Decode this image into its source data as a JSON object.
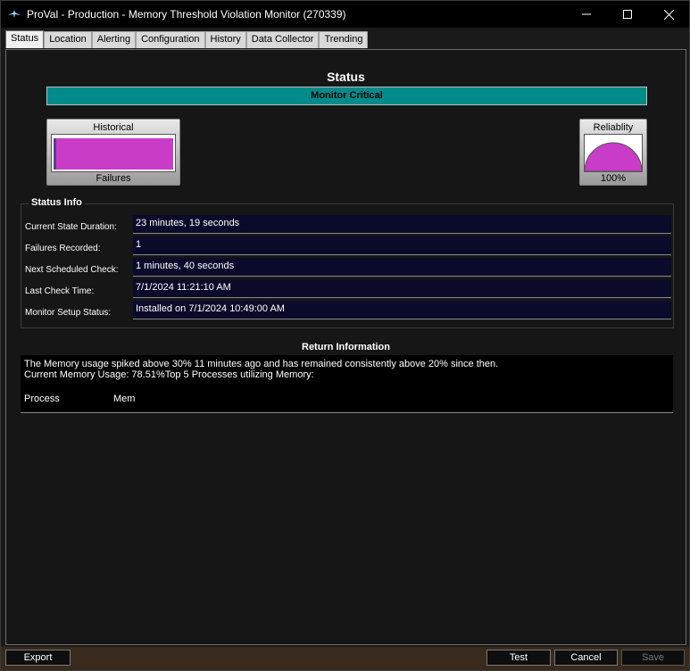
{
  "window": {
    "title": "ProVal - Production - Memory Threshold Violation Monitor (270339)",
    "minimize_label": "—",
    "maximize_label": "☐",
    "close_label": "✕"
  },
  "tabs": [
    {
      "label": "Status"
    },
    {
      "label": "Location"
    },
    {
      "label": "Alerting"
    },
    {
      "label": "Configuration"
    },
    {
      "label": "History"
    },
    {
      "label": "Data Collector"
    },
    {
      "label": "Trending"
    }
  ],
  "status": {
    "heading": "Status",
    "monitor_state": "Monitor Critical",
    "state_color": "#008b8b"
  },
  "historical": {
    "title": "Historical",
    "label": "Failures",
    "bar_color": "#c83cc8"
  },
  "reliability": {
    "title": "Reliablity",
    "value_label": "100%",
    "value_fraction": 1.0,
    "fill_color": "#c83cc8"
  },
  "status_info": {
    "title": "Status Info",
    "rows": [
      {
        "label": "Current State Duration:",
        "value": "23 minutes, 19 seconds"
      },
      {
        "label": "Failures Recorded:",
        "value": "1"
      },
      {
        "label": "Next Scheduled Check:",
        "value": "1 minutes, 40 seconds"
      },
      {
        "label": "Last Check Time:",
        "value": "7/1/2024 11:21:10 AM"
      },
      {
        "label": "Monitor Setup Status:",
        "value": "Installed on 7/1/2024 10:49:00 AM"
      }
    ]
  },
  "return_info": {
    "heading": "Return Information",
    "line1": "The Memory usage spiked above 30% 11 minutes ago and has remained consistently above 20% since then.",
    "line2": "Current Memory Usage: 78.51%Top 5 Processes utilizing Memory:",
    "col_process": "Process",
    "col_mem": "Mem"
  },
  "footer": {
    "export_label": "Export",
    "test_label": "Test",
    "cancel_label": "Cancel",
    "save_label": "Save"
  }
}
